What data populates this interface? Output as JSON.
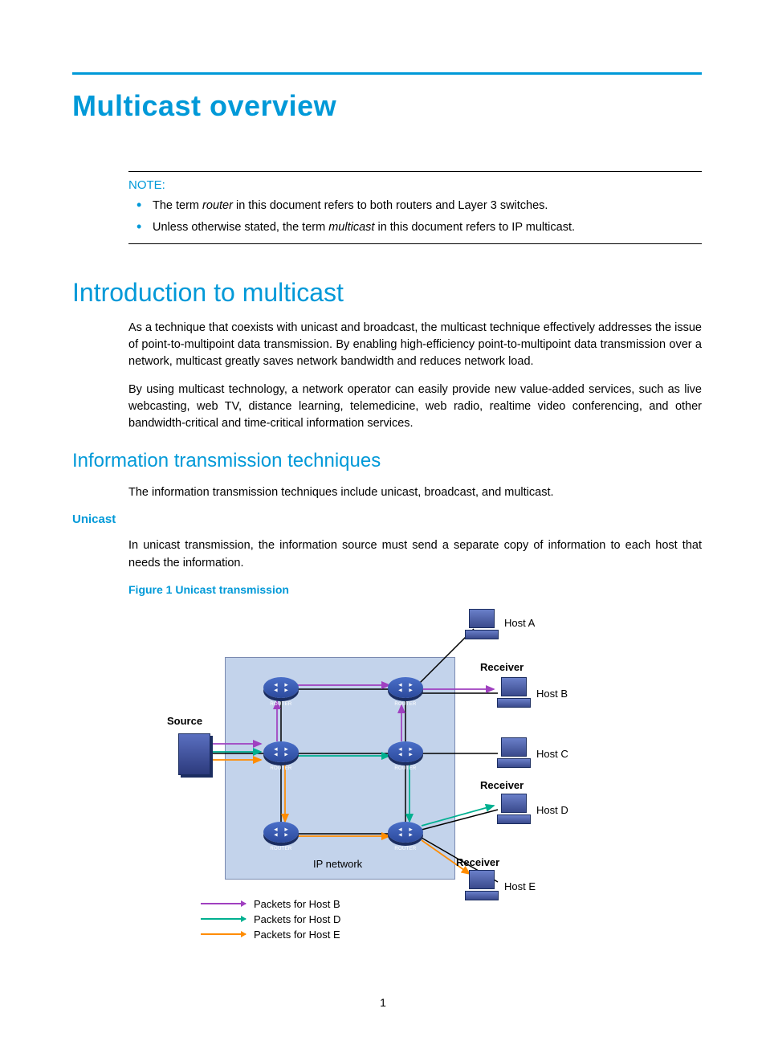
{
  "title": "Multicast overview",
  "note": {
    "label": "NOTE:",
    "items": [
      {
        "pre": "The term ",
        "em": "router",
        "post": " in this document refers to both routers and Layer 3 switches."
      },
      {
        "pre": "Unless otherwise stated, the term ",
        "em": "multicast",
        "post": " in this document refers to IP multicast."
      }
    ]
  },
  "section1": {
    "heading": "Introduction to multicast",
    "p1": "As a technique that coexists with unicast and broadcast, the multicast technique effectively addresses the issue of point-to-multipoint data transmission. By enabling high-efficiency point-to-multipoint data transmission over a network, multicast greatly saves network bandwidth and reduces network load.",
    "p2": "By using multicast technology, a network operator can easily provide new value-added services, such as live webcasting, web TV, distance learning, telemedicine, web radio, realtime video conferencing, and other bandwidth-critical and time-critical information services."
  },
  "section2": {
    "heading": "Information transmission techniques",
    "p1": "The information transmission techniques include unicast, broadcast, and multicast."
  },
  "unicast": {
    "heading": "Unicast",
    "p1": "In unicast transmission, the information source must send a separate copy of information to each host that needs the information.",
    "figcaption": "Figure 1 Unicast transmission"
  },
  "diagram": {
    "source_label": "Source",
    "ip_label": "IP network",
    "router_label": "ROUTER",
    "hosts": {
      "a": "Host A",
      "b": "Host B",
      "c": "Host C",
      "d": "Host D",
      "e": "Host E"
    },
    "receiver_label": "Receiver",
    "legend": {
      "b": "Packets for Host B",
      "d": "Packets for Host D",
      "e": "Packets for Host E"
    }
  },
  "page_number": "1"
}
